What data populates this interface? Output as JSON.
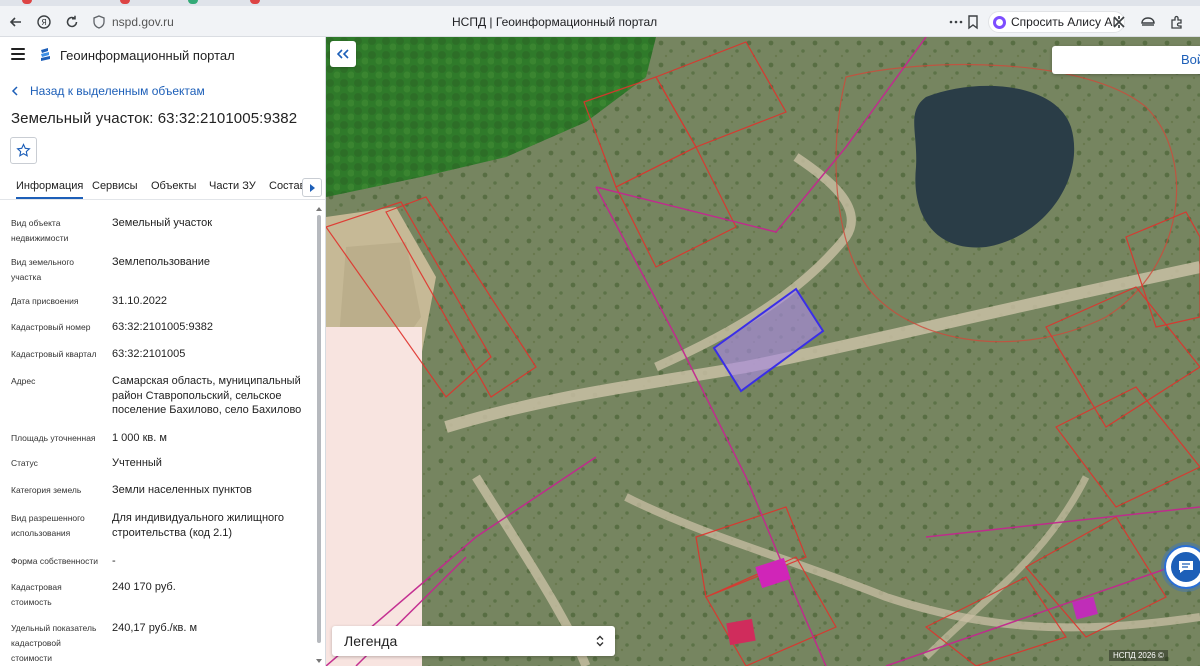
{
  "browser": {
    "url": "nspd.gov.ru",
    "title": "НСПД | Геоинформационный портал",
    "alice_button": "Спросить Алису AI"
  },
  "app": {
    "portal_title": "Геоинформационный портал",
    "back_link": "Назад к выделенным объектам",
    "object_title": "Земельный участок: 63:32:2101005:9382"
  },
  "tabs": [
    {
      "label": "Информация",
      "active": true
    },
    {
      "label": "Сервисы"
    },
    {
      "label": "Объекты"
    },
    {
      "label": "Части ЗУ"
    },
    {
      "label": "Состав"
    }
  ],
  "properties": [
    {
      "label": "Вид объекта недвижимости",
      "value": "Земельный участок"
    },
    {
      "label": "Вид земельного участка",
      "value": "Землепользование"
    },
    {
      "label": "Дата присвоения",
      "value": "31.10.2022"
    },
    {
      "label": "Кадастровый номер",
      "value": "63:32:2101005:9382"
    },
    {
      "label": "Кадастровый квартал",
      "value": "63:32:2101005"
    },
    {
      "label": "Адрес",
      "value": "Самарская область, муниципальный район Ставропольский, сельское поселение Бахилово, село Бахилово"
    },
    {
      "label": "Площадь уточненная",
      "value": "1 000 кв. м"
    },
    {
      "label": "Статус",
      "value": "Учтенный"
    },
    {
      "label": "Категория земель",
      "value": "Земли населенных пунктов"
    },
    {
      "label": "Вид разрешенного использования",
      "value": "Для индивидуального жилищного строительства (код 2.1)"
    },
    {
      "label": "Форма собственности",
      "value": "-"
    },
    {
      "label": "Кадастровая стоимость",
      "value": "240 170 руб."
    },
    {
      "label": "Удельный показатель кадастровой стоимости",
      "value": "240,17 руб./кв. м"
    }
  ],
  "map": {
    "login_label": "Вой",
    "legend_label": "Легенда",
    "copyright": "НСПД 2026 ©"
  },
  "colors": {
    "accent": "#1d5fb8",
    "parcel_border": "#e0322c",
    "quarter_border": "#c2288e",
    "selected_fill": "#a98ae0",
    "selected_border": "#3a2ee8"
  }
}
